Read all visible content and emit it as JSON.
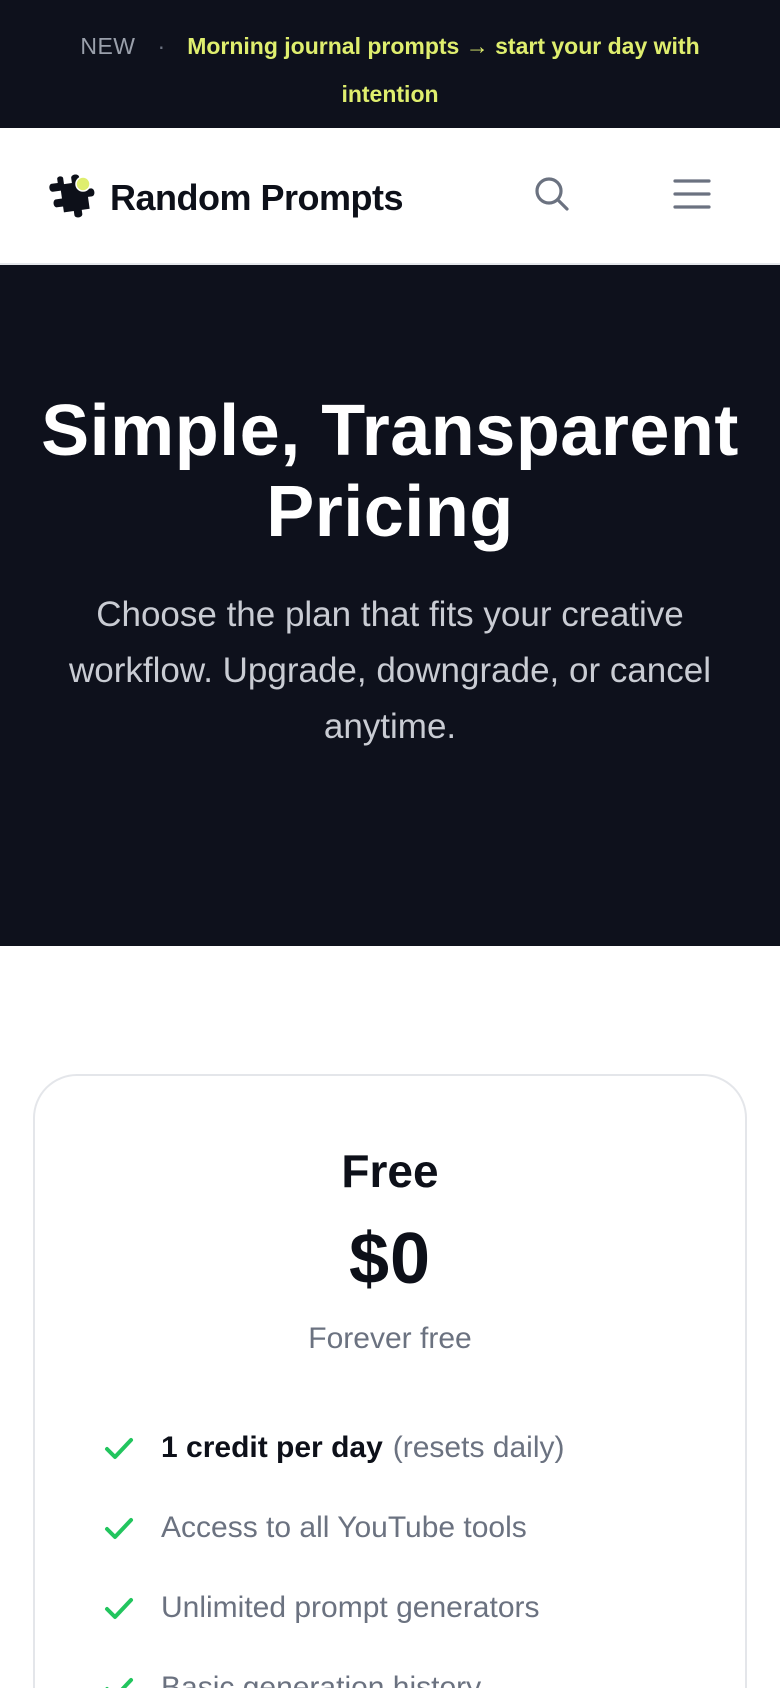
{
  "announcement": {
    "tag": "NEW",
    "separator": "·",
    "message": "Morning journal prompts → start your day with intention"
  },
  "nav": {
    "brand": "Random Prompts",
    "search_icon": "search-icon",
    "menu_icon": "hamburger-menu-icon"
  },
  "hero": {
    "title": "Simple, Transparent Pricing",
    "subtitle": "Choose the plan that fits your creative workflow. Upgrade, downgrade, or cancel anytime."
  },
  "plan": {
    "name": "Free",
    "price": "$0",
    "period": "Forever free",
    "features": [
      {
        "bold": "1 credit per day",
        "text": "(resets daily)"
      },
      {
        "bold": "",
        "text": "Access to all YouTube tools"
      },
      {
        "bold": "",
        "text": "Unlimited prompt generators"
      },
      {
        "bold": "",
        "text": "Basic generation history"
      }
    ]
  },
  "colors": {
    "dark_bg": "#0e111c",
    "accent_yellow": "#dfee6e",
    "check_green": "#22c55e"
  }
}
